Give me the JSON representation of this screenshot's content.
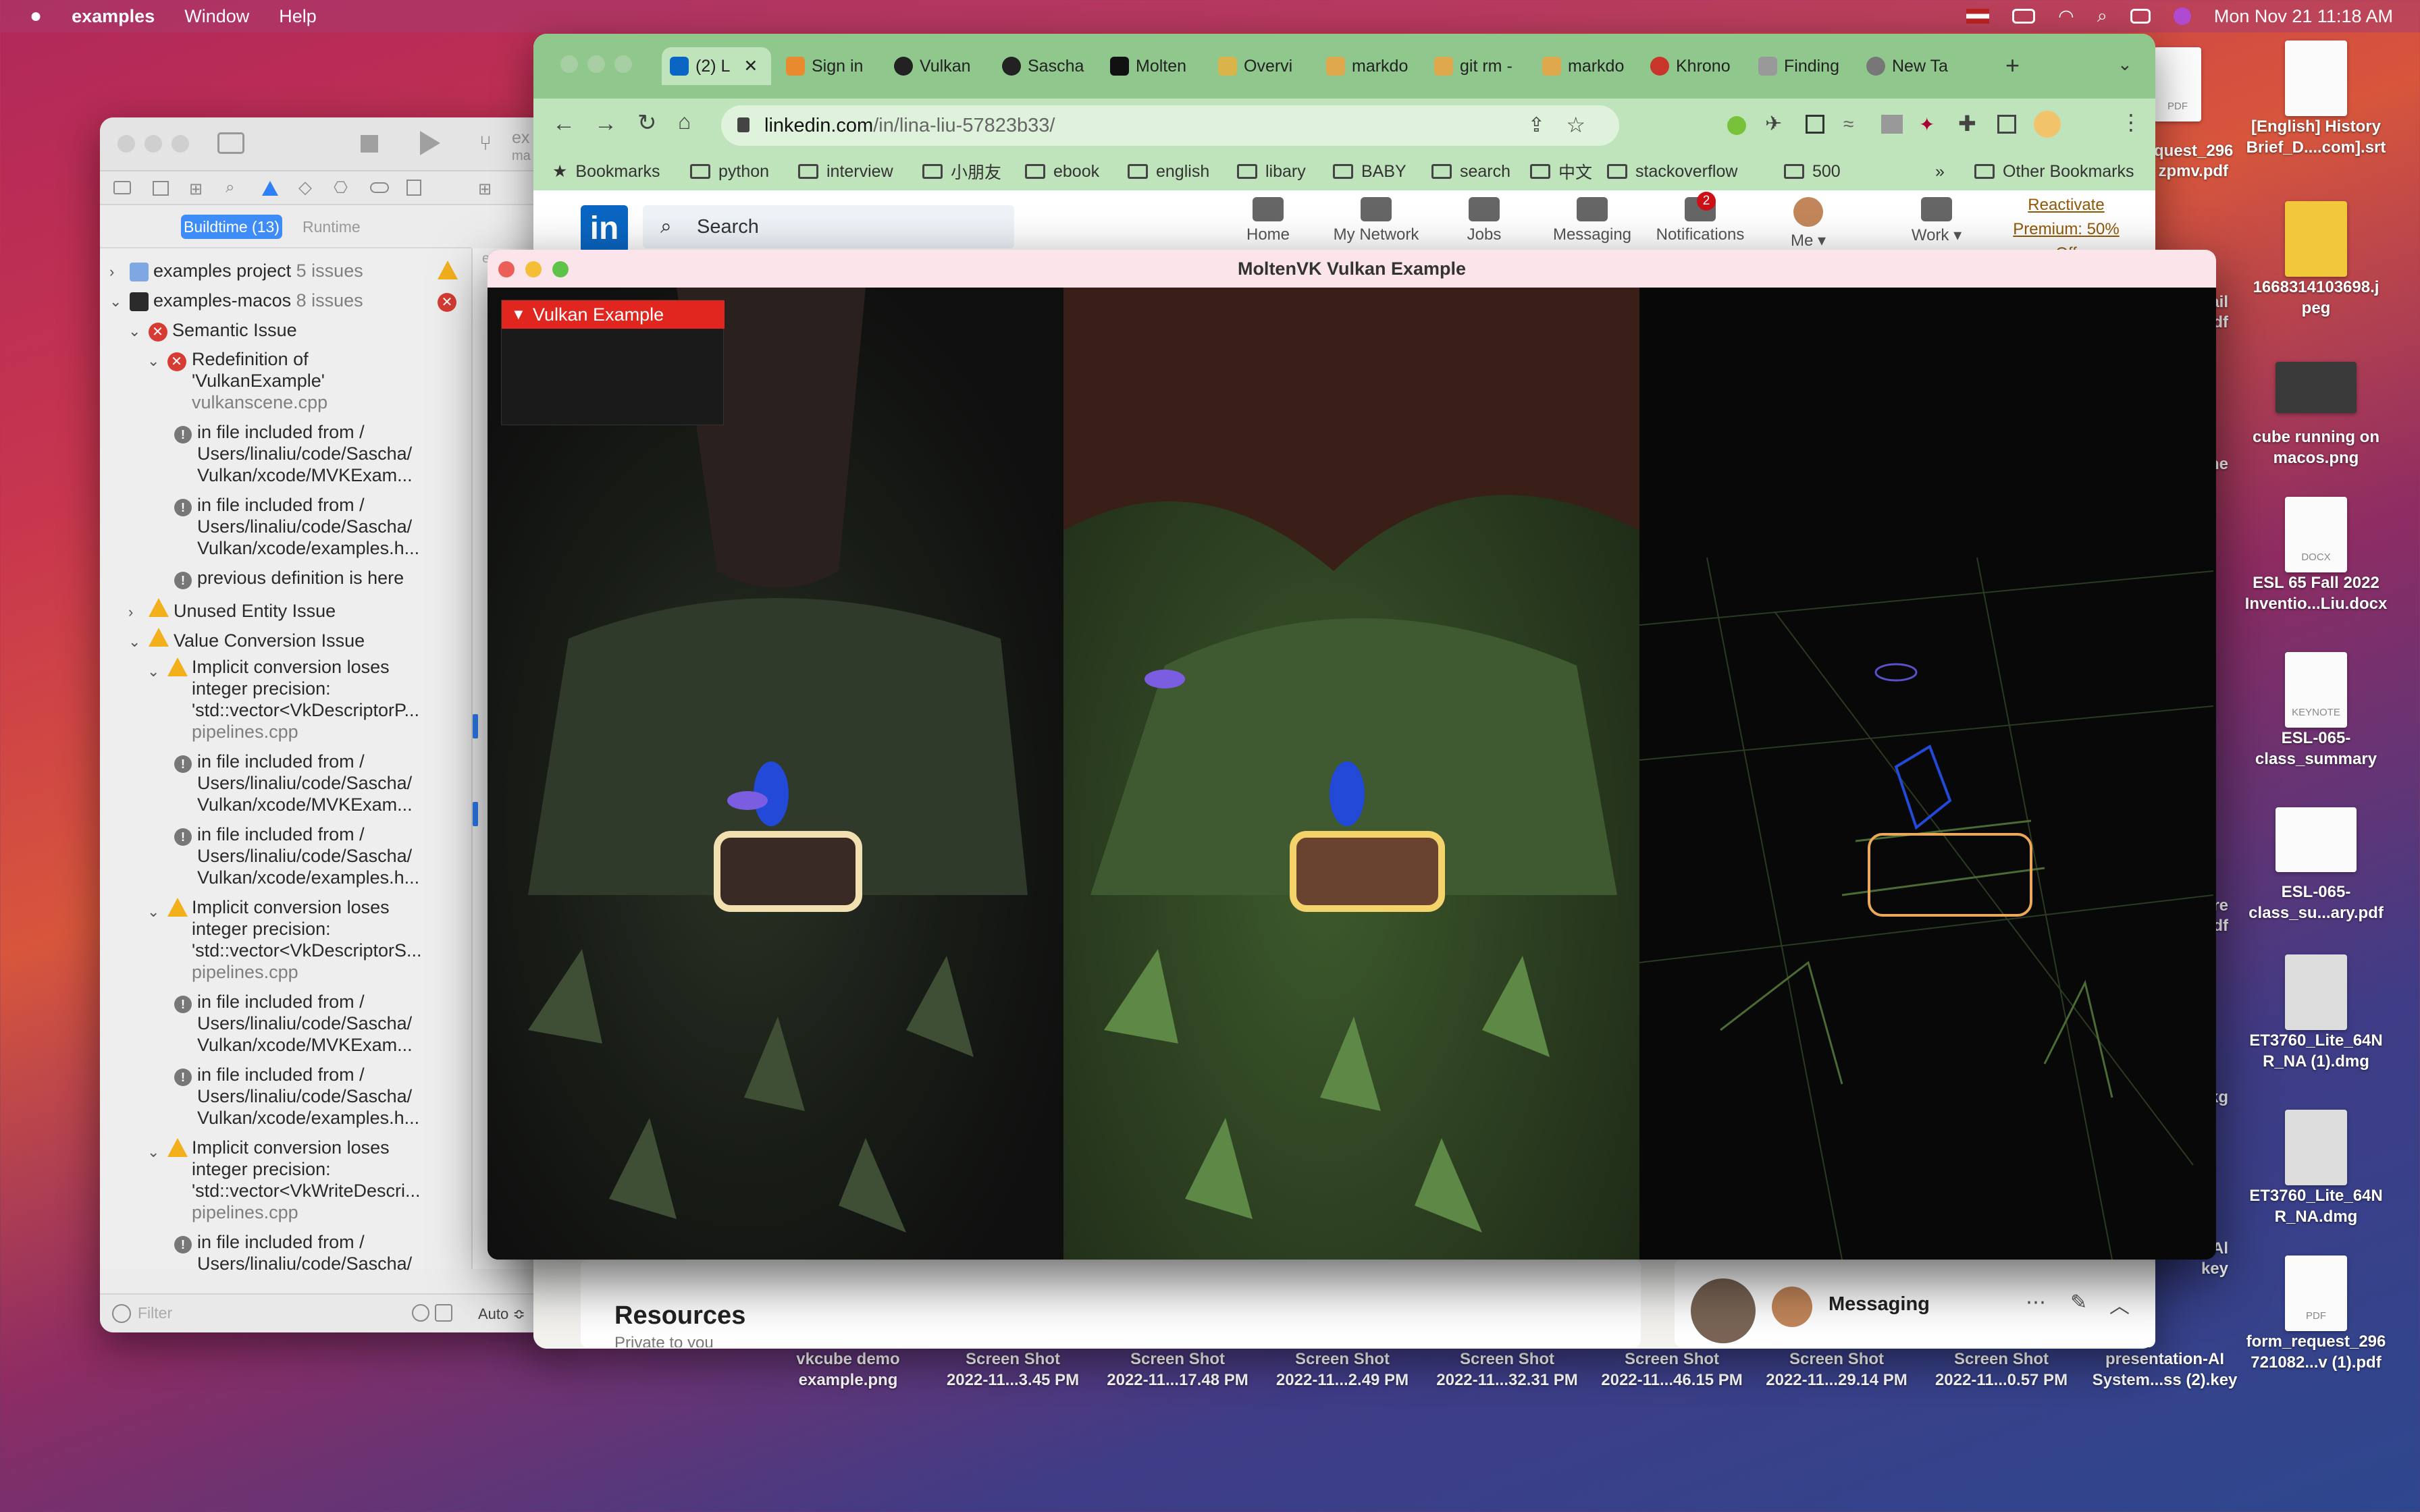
{
  "menubar": {
    "apple": "",
    "app": "examples",
    "items": [
      "Window",
      "Help"
    ],
    "datetime": "Mon Nov 21  11:18 AM"
  },
  "desktop": {
    "right_col": [
      {
        "label1": "[English] History",
        "label2": "Brief_D....com].srt",
        "ext": ""
      },
      {
        "label1": "1668314103698.j",
        "label2": "peg",
        "ext": ""
      },
      {
        "label1": "cube running on",
        "label2": "macos.png",
        "ext": ""
      },
      {
        "label1": "ESL 65 Fall 2022",
        "label2": "Inventio...Liu.docx",
        "ext": "DOCX"
      },
      {
        "label1": "ESL-065-",
        "label2": "class_summary",
        "ext": "KEYNOTE"
      },
      {
        "label1": "ESL-065-",
        "label2": "class_su...ary.pdf",
        "ext": ""
      },
      {
        "label1": "ET3760_Lite_64N",
        "label2": "R_NA (1).dmg",
        "ext": ""
      },
      {
        "label1": "ET3760_Lite_64N",
        "label2": "R_NA.dmg",
        "ext": ""
      },
      {
        "label1": "form_request_296",
        "label2": "721082...v (1).pdf",
        "ext": "PDF"
      }
    ],
    "partial_col": [
      {
        "label1": "quest_296",
        "label2": "zpmv.pdf",
        "ext": "PDF"
      },
      {
        "label1": "ail",
        "label2": "pdf",
        "ext": ""
      },
      {
        "label1": "ne",
        "label2": "",
        "ext": ""
      },
      {
        "label1": "re",
        "label2": "pdf",
        "ext": ""
      },
      {
        "label1": "pkg",
        "label2": "",
        "ext": ""
      },
      {
        "label1": "Al",
        "label2": "key",
        "ext": ""
      }
    ],
    "bottom_row": [
      {
        "label1": "vkcube demo",
        "label2": "example.png"
      },
      {
        "label1": "Screen Shot",
        "label2": "2022-11...3.45 PM"
      },
      {
        "label1": "Screen Shot",
        "label2": "2022-11...17.48 PM"
      },
      {
        "label1": "Screen Shot",
        "label2": "2022-11...2.49 PM"
      },
      {
        "label1": "Screen Shot",
        "label2": "2022-11...32.31 PM"
      },
      {
        "label1": "Screen Shot",
        "label2": "2022-11...46.15 PM"
      },
      {
        "label1": "Screen Shot",
        "label2": "2022-11...29.14 PM"
      },
      {
        "label1": "Screen Shot",
        "label2": "2022-11...0.57 PM"
      },
      {
        "label1": "presentation-AI",
        "label2": "System...ss (2).key"
      },
      {
        "label1": "form_request_296",
        "label2": "721082...v (1).pdf"
      }
    ]
  },
  "xcode": {
    "tabs": [
      "Buildtime (13)",
      "Runtime"
    ],
    "filter_placeholder": "Filter",
    "editor_partial": {
      "title1": "ex",
      "title2": "ma",
      "tab": "exa",
      "auto": "Auto ≎"
    },
    "rows": [
      {
        "kind": "project",
        "indent": 0,
        "chev": "›",
        "text": "examples project",
        "sub": "5 issues",
        "badge": "warn"
      },
      {
        "kind": "project",
        "indent": 0,
        "chev": "⌄",
        "text": "examples-macos",
        "sub": "8 issues",
        "badge": "err"
      },
      {
        "kind": "group",
        "indent": 1,
        "chev": "⌄",
        "icon": "err",
        "text": "Semantic Issue"
      },
      {
        "kind": "issue",
        "indent": 2,
        "chev": "⌄",
        "icon": "err",
        "lines": [
          "Redefinition of",
          "'VulkanExample'"
        ],
        "file": "vulkanscene.cpp"
      },
      {
        "kind": "note",
        "indent": 3,
        "icon": "note",
        "lines": [
          "in file included from /",
          "Users/linaliu/code/Sascha/",
          "Vulkan/xcode/MVKExam..."
        ]
      },
      {
        "kind": "note",
        "indent": 3,
        "icon": "note",
        "lines": [
          "in file included from /",
          "Users/linaliu/code/Sascha/",
          "Vulkan/xcode/examples.h..."
        ]
      },
      {
        "kind": "note",
        "indent": 3,
        "icon": "note",
        "lines": [
          "previous definition is here"
        ]
      },
      {
        "kind": "group",
        "indent": 1,
        "chev": "›",
        "icon": "warn",
        "text": "Unused Entity Issue"
      },
      {
        "kind": "group",
        "indent": 1,
        "chev": "⌄",
        "icon": "warn",
        "text": "Value Conversion Issue"
      },
      {
        "kind": "issue",
        "indent": 2,
        "chev": "⌄",
        "icon": "warn",
        "lines": [
          "Implicit conversion loses",
          "integer precision:",
          "'std::vector<VkDescriptorP..."
        ],
        "file": "pipelines.cpp"
      },
      {
        "kind": "note",
        "indent": 3,
        "icon": "note",
        "lines": [
          "in file included from /",
          "Users/linaliu/code/Sascha/",
          "Vulkan/xcode/MVKExam..."
        ]
      },
      {
        "kind": "note",
        "indent": 3,
        "icon": "note",
        "lines": [
          "in file included from /",
          "Users/linaliu/code/Sascha/",
          "Vulkan/xcode/examples.h..."
        ]
      },
      {
        "kind": "issue",
        "indent": 2,
        "chev": "⌄",
        "icon": "warn",
        "lines": [
          "Implicit conversion loses",
          "integer precision:",
          "'std::vector<VkDescriptorS..."
        ],
        "file": "pipelines.cpp"
      },
      {
        "kind": "note",
        "indent": 3,
        "icon": "note",
        "lines": [
          "in file included from /",
          "Users/linaliu/code/Sascha/",
          "Vulkan/xcode/MVKExam..."
        ]
      },
      {
        "kind": "note",
        "indent": 3,
        "icon": "note",
        "lines": [
          "in file included from /",
          "Users/linaliu/code/Sascha/",
          "Vulkan/xcode/examples.h..."
        ]
      },
      {
        "kind": "issue",
        "indent": 2,
        "chev": "⌄",
        "icon": "warn",
        "lines": [
          "Implicit conversion loses",
          "integer precision:",
          "'std::vector<VkWriteDescri..."
        ],
        "file": "pipelines.cpp"
      },
      {
        "kind": "note",
        "indent": 3,
        "icon": "note",
        "lines": [
          "in file included from /",
          "Users/linaliu/code/Sascha/"
        ]
      }
    ]
  },
  "chrome": {
    "tabs": [
      "(2) L",
      "Sign in",
      "Vulkan",
      "Sascha",
      "Molten",
      "Overvi",
      "markdo",
      "git rm -",
      "markdo",
      "Khrono",
      "Finding",
      "New Ta"
    ],
    "url": "linkedin.com/in/lina-liu-57823b33/",
    "url_host": "linkedin.com",
    "url_path": "/in/lina-liu-57823b33/",
    "bookmarks": [
      "Bookmarks",
      "python",
      "interview",
      "小朋友",
      "ebook",
      "english",
      "libary",
      "BABY",
      "search",
      "中文",
      "stackoverflow",
      "500"
    ],
    "bookmarks_more": "»",
    "other_bookmarks": "Other Bookmarks"
  },
  "linkedin": {
    "logo": "in",
    "search_placeholder": "Search",
    "nav": [
      "Home",
      "My Network",
      "Jobs",
      "Messaging",
      "Notifications",
      "Me ▾",
      "Work ▾"
    ],
    "notif_count": "2",
    "premium": [
      "Reactivate",
      "Premium: 50%",
      "Off"
    ],
    "resources": "Resources",
    "resources_sub": "Private to you",
    "messaging": "Messaging"
  },
  "vulkan": {
    "title": "MoltenVK Vulkan Example",
    "overlay_title": "Vulkan Example",
    "colors": {
      "overlay_red": "#e0261f",
      "chest_gold": "#f3d588",
      "flame_blue": "#2249d8",
      "grass": "#4c6a33"
    }
  }
}
